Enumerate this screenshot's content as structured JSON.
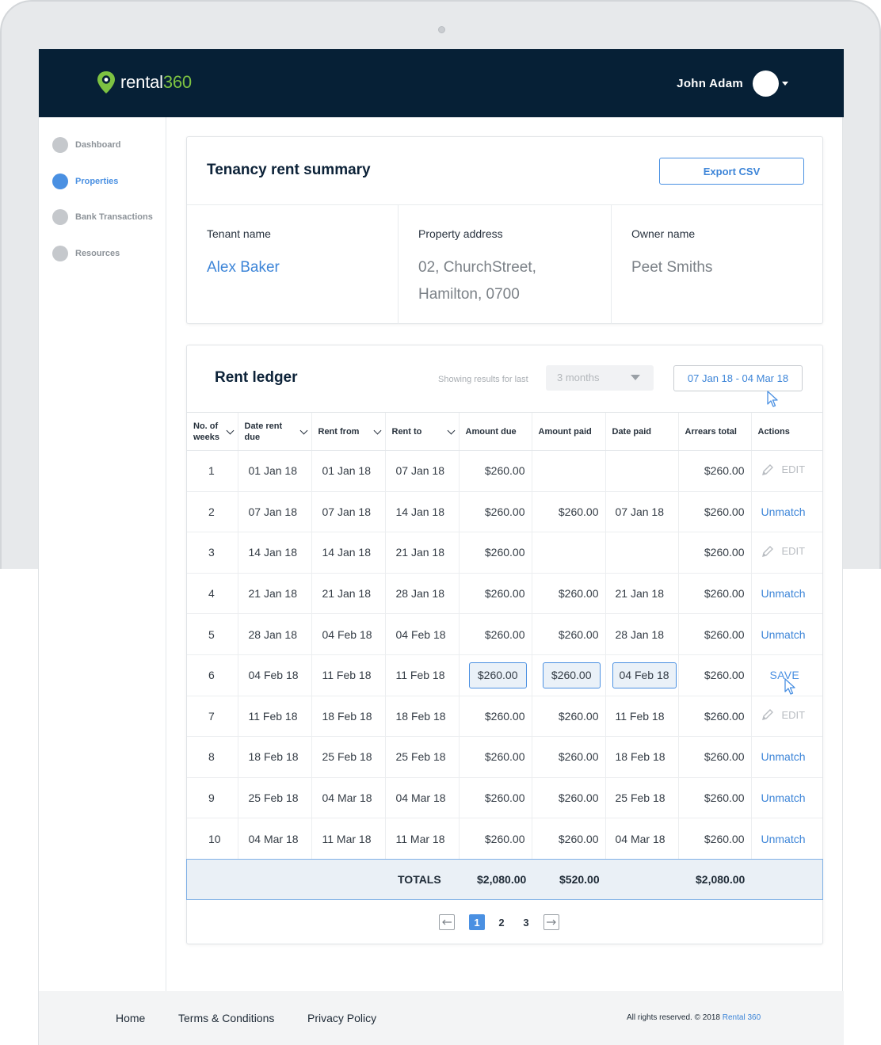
{
  "app": {
    "logo_word": "rental",
    "logo_num": "360",
    "user_name": "John Adam"
  },
  "sidebar": {
    "items": [
      {
        "label": "Dashboard",
        "active": false
      },
      {
        "label": "Properties",
        "active": true
      },
      {
        "label": "Bank Transactions",
        "active": false
      },
      {
        "label": "Resources",
        "active": false
      }
    ]
  },
  "summary": {
    "title": "Tenancy rent summary",
    "export_label": "Export CSV",
    "tenant_label": "Tenant name",
    "tenant_value": "Alex Baker",
    "address_label": "Property address",
    "address_line1": "02, ChurchStreet,",
    "address_line2": "Hamilton, 0700",
    "owner_label": "Owner name",
    "owner_value": "Peet Smiths"
  },
  "ledger": {
    "title": "Rent ledger",
    "showing_label": "Showing results for last",
    "period_value": "3 months",
    "date_range": "07 Jan 18 - 04 Mar 18",
    "columns": {
      "weeks_line1": "No. of",
      "weeks_line2": "weeks",
      "due_line1": "Date rent",
      "due_line2": "due",
      "rent_from": "Rent from",
      "rent_to": "Rent to",
      "amount_due": "Amount due",
      "amount_paid": "Amount paid",
      "date_paid": "Date paid",
      "arrears": "Arrears total",
      "actions": "Actions"
    },
    "rows": [
      {
        "weeks": "1",
        "due": "01 Jan 18",
        "from": "01 Jan 18",
        "to": "07 Jan 18",
        "amount_due": "$260.00",
        "amount_paid": "",
        "date_paid": "",
        "arrears": "$260.00",
        "action": "EDIT"
      },
      {
        "weeks": "2",
        "due": "07 Jan 18",
        "from": "07 Jan 18",
        "to": "14 Jan 18",
        "amount_due": "$260.00",
        "amount_paid": "$260.00",
        "date_paid": "07 Jan 18",
        "arrears": "$260.00",
        "action": "Unmatch"
      },
      {
        "weeks": "3",
        "due": "14 Jan 18",
        "from": "14 Jan 18",
        "to": "21 Jan 18",
        "amount_due": "$260.00",
        "amount_paid": "",
        "date_paid": "",
        "arrears": "$260.00",
        "action": "EDIT"
      },
      {
        "weeks": "4",
        "due": "21 Jan 18",
        "from": "21 Jan 18",
        "to": "28 Jan 18",
        "amount_due": "$260.00",
        "amount_paid": "$260.00",
        "date_paid": "21 Jan 18",
        "arrears": "$260.00",
        "action": "Unmatch"
      },
      {
        "weeks": "5",
        "due": "28 Jan 18",
        "from": "04 Feb 18",
        "to": "04 Feb 18",
        "amount_due": "$260.00",
        "amount_paid": "$260.00",
        "date_paid": "28 Jan 18",
        "arrears": "$260.00",
        "action": "Unmatch"
      },
      {
        "weeks": "6",
        "due": "04 Feb 18",
        "from": "11 Feb 18",
        "to": "11 Feb 18",
        "amount_due": "$260.00",
        "amount_paid": "$260.00",
        "date_paid": "04 Feb 18",
        "arrears": "$260.00",
        "action": "SAVE"
      },
      {
        "weeks": "7",
        "due": "11 Feb 18",
        "from": "18 Feb 18",
        "to": "18 Feb 18",
        "amount_due": "$260.00",
        "amount_paid": "$260.00",
        "date_paid": "11 Feb 18",
        "arrears": "$260.00",
        "action": "EDIT"
      },
      {
        "weeks": "8",
        "due": "18 Feb 18",
        "from": "25 Feb 18",
        "to": "25 Feb 18",
        "amount_due": "$260.00",
        "amount_paid": "$260.00",
        "date_paid": "18 Feb 18",
        "arrears": "$260.00",
        "action": "Unmatch"
      },
      {
        "weeks": "9",
        "due": "25 Feb 18",
        "from": "04 Mar 18",
        "to": "04 Mar 18",
        "amount_due": "$260.00",
        "amount_paid": "$260.00",
        "date_paid": "25 Feb 18",
        "arrears": "$260.00",
        "action": "Unmatch"
      },
      {
        "weeks": "10",
        "due": "04 Mar 18",
        "from": "11 Mar 18",
        "to": "11 Mar 18",
        "amount_due": "$260.00",
        "amount_paid": "$260.00",
        "date_paid": "04 Mar 18",
        "arrears": "$260.00",
        "action": "Unmatch"
      }
    ],
    "totals": {
      "label": "TOTALS",
      "amount_due": "$2,080.00",
      "amount_paid": "$520.00",
      "arrears": "$2,080.00"
    },
    "pagination": {
      "pages": [
        "1",
        "2",
        "3"
      ],
      "current": "1"
    }
  },
  "footer": {
    "home": "Home",
    "terms": "Terms & Conditions",
    "privacy": "Privacy Policy",
    "copyright": "All rights reserved. © 2018 ",
    "brand": "Rental 360"
  },
  "colors": {
    "header_bg": "#062036",
    "accent": "#4a90e2",
    "logo_green": "#7dc242"
  }
}
